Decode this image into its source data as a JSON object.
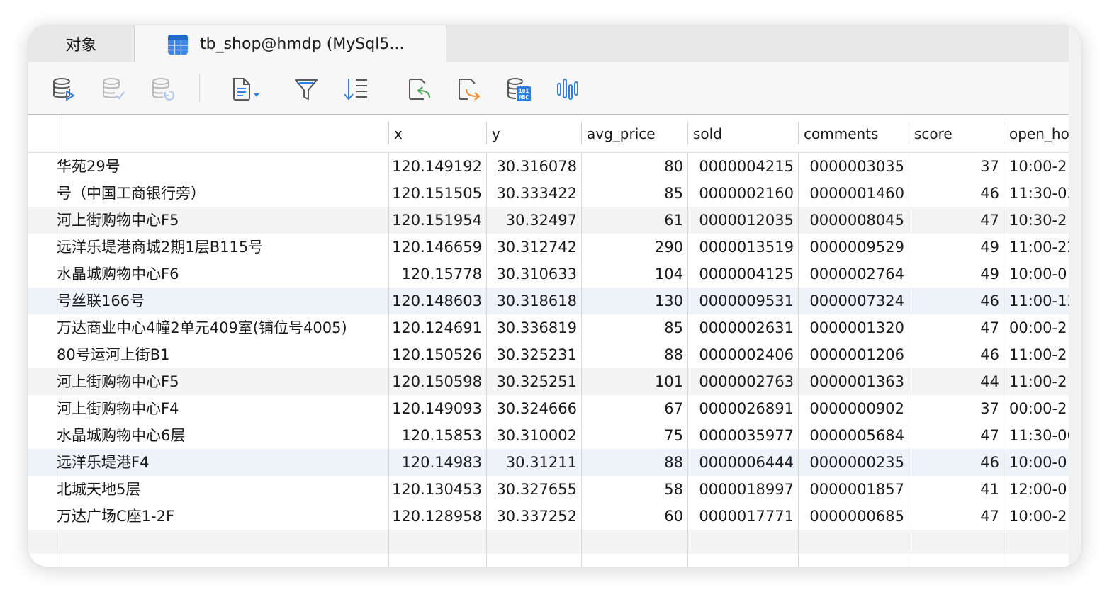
{
  "tabs": {
    "objects_label": "对象",
    "active_label": "tb_shop@hmdp (MySql5..."
  },
  "toolbar": {
    "icons": [
      "database-run-icon",
      "database-check-icon",
      "database-refresh-icon",
      "document-menu-icon",
      "filter-icon",
      "sort-icon",
      "import-icon",
      "export-icon",
      "data-generate-icon",
      "chart-icon"
    ]
  },
  "columns": [
    "",
    "x",
    "y",
    "avg_price",
    "sold",
    "comments",
    "score",
    "open_ho"
  ],
  "rows": [
    [
      "华苑29号",
      "120.149192",
      "30.316078",
      "80",
      "0000004215",
      "0000003035",
      "37",
      "10:00-2"
    ],
    [
      "号（中国工商银行旁）",
      "120.151505",
      "30.333422",
      "85",
      "0000002160",
      "0000001460",
      "46",
      "11:30-03"
    ],
    [
      "河上街购物中心F5",
      "120.151954",
      "30.32497",
      "61",
      "0000012035",
      "0000008045",
      "47",
      "10:30-2"
    ],
    [
      "远洋乐堤港商城2期1层B115号",
      "120.146659",
      "30.312742",
      "290",
      "0000013519",
      "0000009529",
      "49",
      "11:00-22"
    ],
    [
      "水晶城购物中心F6",
      "120.15778",
      "30.310633",
      "104",
      "0000004125",
      "0000002764",
      "49",
      "10:00-0"
    ],
    [
      "号丝联166号",
      "120.148603",
      "30.318618",
      "130",
      "0000009531",
      "0000007324",
      "46",
      "11:00-13"
    ],
    [
      "万达商业中心4幢2单元409室(铺位号4005)",
      "120.124691",
      "30.336819",
      "85",
      "0000002631",
      "0000001320",
      "47",
      "00:00-2"
    ],
    [
      "80号运河上街B1",
      "120.150526",
      "30.325231",
      "88",
      "0000002406",
      "0000001206",
      "46",
      "11:00-2"
    ],
    [
      "河上街购物中心F5",
      "120.150598",
      "30.325251",
      "101",
      "0000002763",
      "0000001363",
      "44",
      "11:00-21"
    ],
    [
      "河上街购物中心F4",
      "120.149093",
      "30.324666",
      "67",
      "0000026891",
      "0000000902",
      "37",
      "00:00-2"
    ],
    [
      "水晶城购物中心6层",
      "120.15853",
      "30.310002",
      "75",
      "0000035977",
      "0000005684",
      "47",
      "11:30-06"
    ],
    [
      "远洋乐堤港F4",
      "120.14983",
      "30.31211",
      "88",
      "0000006444",
      "0000000235",
      "46",
      "10:00-0"
    ],
    [
      "北城天地5层",
      "120.130453",
      "30.327655",
      "58",
      "0000018997",
      "0000001857",
      "41",
      "12:00-0"
    ],
    [
      "万达广场C座1-2F",
      "120.128958",
      "30.337252",
      "60",
      "0000017771",
      "0000000685",
      "47",
      "10:00-2"
    ]
  ],
  "colors": {
    "accent": "#2f7fe0",
    "row_alt": "#f4f4f4",
    "row_highlight": "#eef3fa"
  }
}
